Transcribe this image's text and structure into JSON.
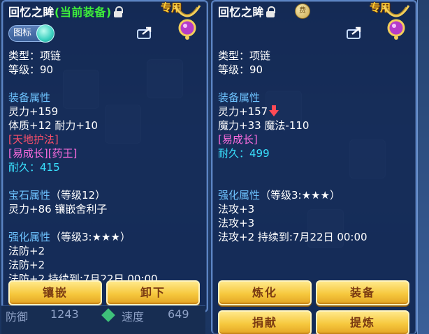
{
  "left_panel": {
    "title": "回忆之眸",
    "current_tag": "(当前装备)",
    "exclusive_badge": "专用",
    "toggle_label": "图标",
    "type_line": "类型：项链",
    "level_line": "等级：90",
    "attr_title": "装备属性",
    "attr_lines": [
      "灵力+159",
      "体质+12 耐力+10"
    ],
    "red_tag": "[天地护法]",
    "mag_tag": "[易成长][药王]",
    "durability": "耐久：415",
    "gem_title": "宝石属性",
    "gem_level": "（等级12）",
    "gem_line": "灵力+86 镶嵌舍利子",
    "enhance_title": "强化属性",
    "enhance_level": "（等级3:★★★）",
    "enhance_lines": [
      "法防+2",
      "法防+2",
      "法防+2     持续到:7月22日 00:00"
    ],
    "buttons": {
      "inlay": "镶嵌",
      "unequip": "卸下"
    }
  },
  "right_panel": {
    "title": "回忆之眸",
    "exclusive_badge": "专用",
    "badge_glyph": "费",
    "type_line": "类型：项链",
    "level_line": "等级：90",
    "attr_title": "装备属性",
    "attr_line1": "灵力+157",
    "attr_line2": "魔力+33 魔法-110",
    "mag_tag": "[易成长]",
    "durability": "耐久：499",
    "enhance_title": "强化属性",
    "enhance_level": "（等级3:★★★）",
    "enhance_lines": [
      "法攻+3",
      "法攻+3",
      "法攻+2     持续到:7月22日 00:00"
    ],
    "buttons": {
      "refine": "炼化",
      "equip": "装备",
      "donate": "捐献",
      "extract": "提炼"
    }
  },
  "background": {
    "stat_label": "防御",
    "stat_value": "1243",
    "speed_label": "速度",
    "speed_value": "649"
  },
  "colors": {
    "accent_gold": "#ffcc33",
    "section_blue": "#6ec3ff",
    "tag_red": "#ff4f6a",
    "tag_magenta": "#ff6de0",
    "durability_cyan": "#39e2ff",
    "current_green": "#3df03a"
  }
}
